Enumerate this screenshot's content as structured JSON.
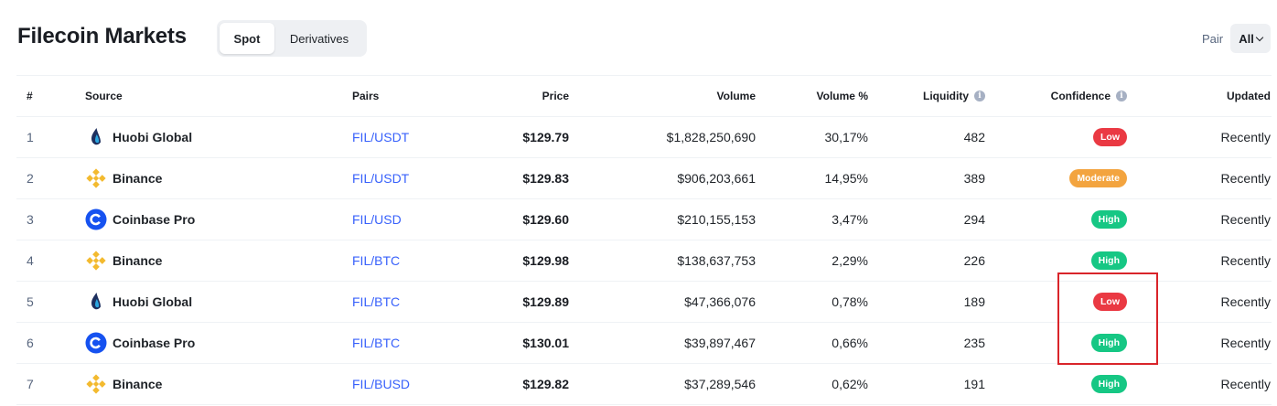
{
  "header": {
    "title": "Filecoin Markets",
    "tabs": [
      {
        "label": "Spot",
        "active": true
      },
      {
        "label": "Derivatives",
        "active": false
      }
    ],
    "pair_label": "Pair",
    "pair_value": "All"
  },
  "table": {
    "columns": [
      "#",
      "Source",
      "Pairs",
      "Price",
      "Volume",
      "Volume %",
      "Liquidity",
      "Confidence",
      "Updated"
    ],
    "rows": [
      {
        "rank": "1",
        "source": "Huobi Global",
        "logo": "huobi-logo",
        "pair": "FIL/USDT",
        "price": "$129.79",
        "volume": "$1,828,250,690",
        "volume_pct": "30,17%",
        "liquidity": "482",
        "confidence": "Low",
        "updated": "Recently"
      },
      {
        "rank": "2",
        "source": "Binance",
        "logo": "binance-logo",
        "pair": "FIL/USDT",
        "price": "$129.83",
        "volume": "$906,203,661",
        "volume_pct": "14,95%",
        "liquidity": "389",
        "confidence": "Moderate",
        "updated": "Recently"
      },
      {
        "rank": "3",
        "source": "Coinbase Pro",
        "logo": "coinbase-logo",
        "pair": "FIL/USD",
        "price": "$129.60",
        "volume": "$210,155,153",
        "volume_pct": "3,47%",
        "liquidity": "294",
        "confidence": "High",
        "updated": "Recently"
      },
      {
        "rank": "4",
        "source": "Binance",
        "logo": "binance-logo",
        "pair": "FIL/BTC",
        "price": "$129.98",
        "volume": "$138,637,753",
        "volume_pct": "2,29%",
        "liquidity": "226",
        "confidence": "High",
        "updated": "Recently"
      },
      {
        "rank": "5",
        "source": "Huobi Global",
        "logo": "huobi-logo",
        "pair": "FIL/BTC",
        "price": "$129.89",
        "volume": "$47,366,076",
        "volume_pct": "0,78%",
        "liquidity": "189",
        "confidence": "Low",
        "updated": "Recently"
      },
      {
        "rank": "6",
        "source": "Coinbase Pro",
        "logo": "coinbase-logo",
        "pair": "FIL/BTC",
        "price": "$130.01",
        "volume": "$39,897,467",
        "volume_pct": "0,66%",
        "liquidity": "235",
        "confidence": "High",
        "updated": "Recently"
      },
      {
        "rank": "7",
        "source": "Binance",
        "logo": "binance-logo",
        "pair": "FIL/BUSD",
        "price": "$129.82",
        "volume": "$37,289,546",
        "volume_pct": "0,62%",
        "liquidity": "191",
        "confidence": "High",
        "updated": "Recently"
      }
    ]
  },
  "colors": {
    "link": "#3861fb",
    "low": "#ea3943",
    "moderate": "#f3a43f",
    "high": "#16c784",
    "highlight": "#d9242a",
    "binance": "#f3ba2f",
    "coinbase": "#1652f0",
    "huobi": "#1e2f5e"
  }
}
